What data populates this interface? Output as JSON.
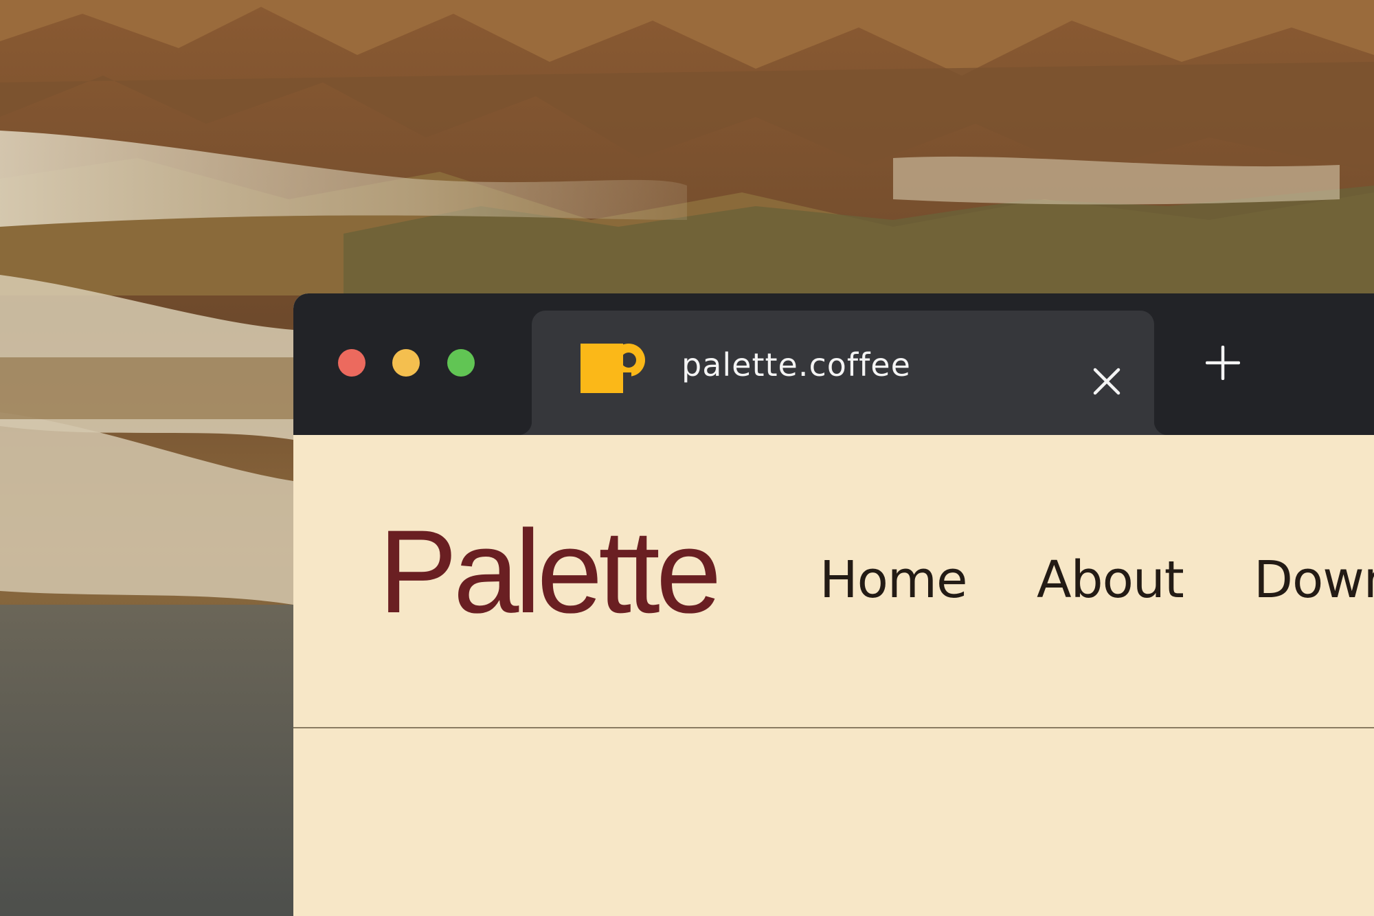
{
  "colors": {
    "window_chrome": "#222327",
    "active_tab": "#36373b",
    "page_background": "#f7e7c7",
    "logo_color": "#6a1f22",
    "nav_text": "#231b15",
    "favicon": "#fbb818",
    "close_button": "#ec6a5e",
    "minimize_button": "#f4bf4f",
    "zoom_button": "#61c554"
  },
  "window": {
    "controls": [
      "close",
      "minimize",
      "zoom"
    ],
    "tab": {
      "favicon": "coffee-cup-icon",
      "title": "palette.coffee",
      "close_icon": "close-icon"
    },
    "new_tab_icon": "plus-icon"
  },
  "site": {
    "logo": "Palette",
    "nav": [
      {
        "label": "Home"
      },
      {
        "label": "About"
      },
      {
        "label": "Down"
      }
    ]
  }
}
